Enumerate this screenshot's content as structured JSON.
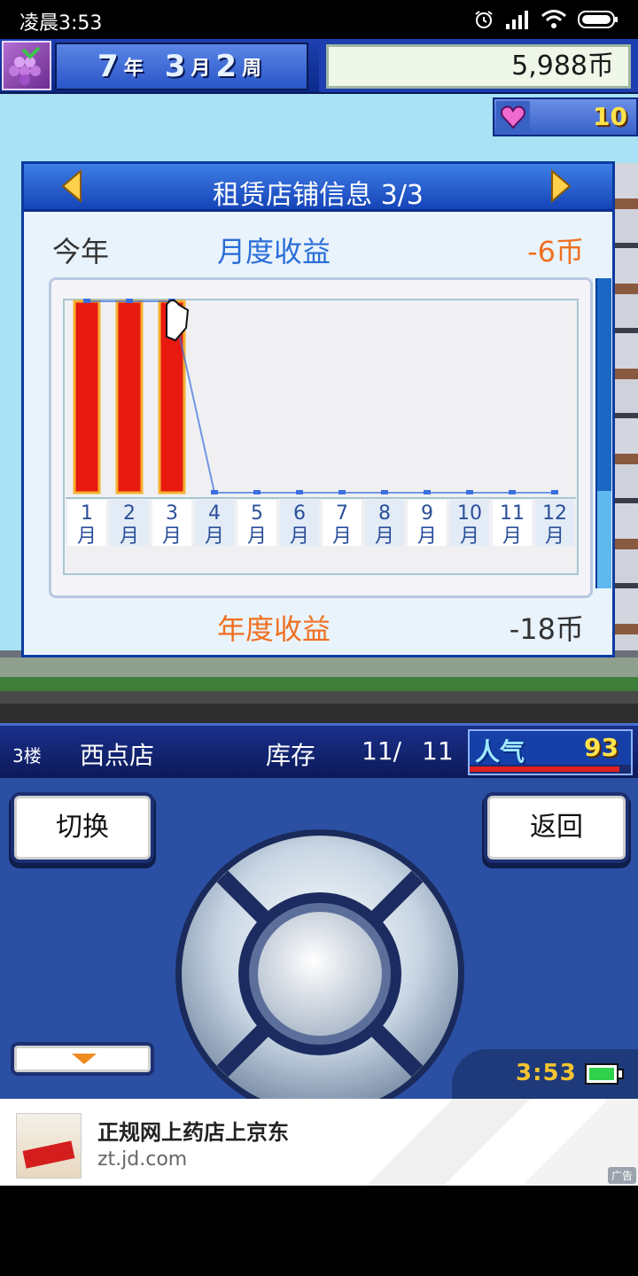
{
  "status_bar": {
    "time": "凌晨3:53",
    "icons": [
      "alarm-icon",
      "signal-icon",
      "wifi-icon",
      "battery-icon"
    ]
  },
  "hud": {
    "year_num": "7",
    "year_unit": "年",
    "month_num": "3",
    "month_unit": "月",
    "week_num": "2",
    "week_unit": "周",
    "money": "5,988币",
    "favor": "10"
  },
  "panel": {
    "title": "租赁店铺信息 3/3",
    "year_label": "今年",
    "monthly_label": "月度收益",
    "monthly_value": "-6币",
    "annual_label": "年度收益",
    "annual_value": "-18币"
  },
  "chart_data": {
    "type": "bar",
    "categories": [
      "1月",
      "2月",
      "3月",
      "4月",
      "5月",
      "6月",
      "7月",
      "8月",
      "9月",
      "10月",
      "11月",
      "12月"
    ],
    "values": [
      1,
      1,
      1,
      0,
      0,
      0,
      0,
      0,
      0,
      0,
      0,
      0
    ],
    "bar_color": "#e81a10",
    "line_color": "#3b6fe0"
  },
  "info_bar": {
    "floor": "3楼",
    "shop_name": "西点店",
    "stock_label": "库存",
    "stock_current": "11/",
    "stock_max": "11",
    "popularity_label": "人气",
    "popularity_value": "93",
    "popularity_fill": 0.93
  },
  "controls": {
    "switch_label": "切换",
    "back_label": "返回",
    "clock": "3:53"
  },
  "ad": {
    "title": "正规网上药店上京东",
    "url": "zt.jd.com",
    "tag": "广告"
  }
}
